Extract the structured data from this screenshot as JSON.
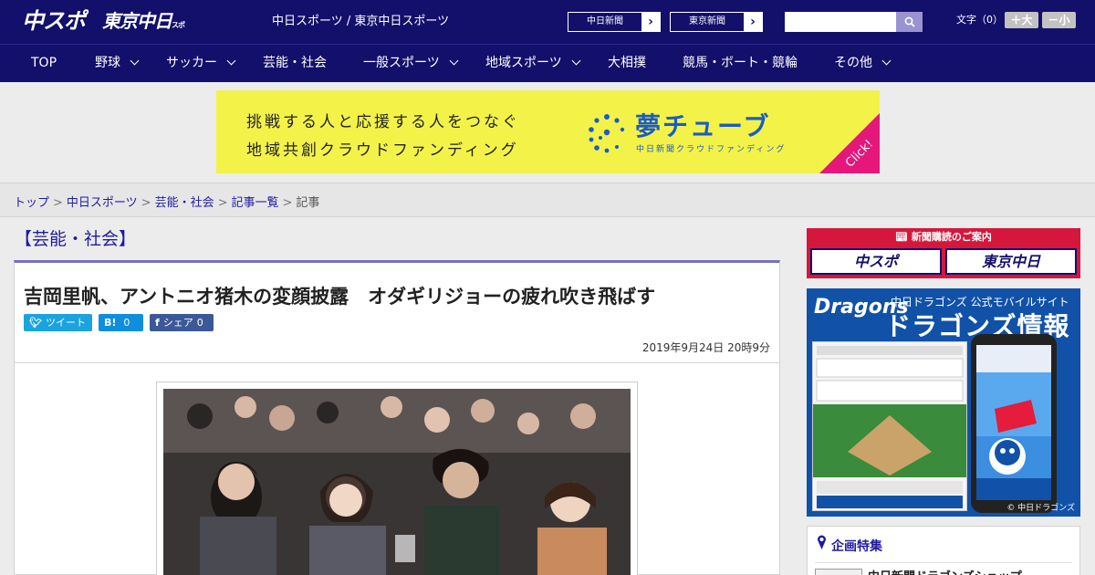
{
  "header": {
    "logo_chuspo": "中スポ",
    "logo_tokyo": "東京中日",
    "logo_tokyo_small": "スポーツ",
    "site_links": "中日スポーツ / 東京中日スポーツ",
    "paper1": "中日新聞",
    "paper2": "東京新聞",
    "search_placeholder": "",
    "font_label": "文字（0）",
    "font_big": "＋大",
    "font_small": "－小"
  },
  "nav": [
    {
      "label": "TOP"
    },
    {
      "label": "野球"
    },
    {
      "label": "サッカー"
    },
    {
      "label": "芸能・社会"
    },
    {
      "label": "一般スポーツ"
    },
    {
      "label": "地域スポーツ"
    },
    {
      "label": "大相撲"
    },
    {
      "label": "競馬・ボート・競輪"
    },
    {
      "label": "その他"
    }
  ],
  "ad": {
    "line1": "挑戦する人と応援する人をつなぐ",
    "line2": "地域共創クラウドファンディング",
    "brand": "夢チューブ",
    "sub": "中日新聞クラウドファンディング",
    "click": "Click!",
    "brand_color": "#1c5cc5",
    "bg_color": "#f3f249",
    "corner_color": "#e5177a"
  },
  "breadcrumb": {
    "items": [
      "トップ",
      "中日スポーツ",
      "芸能・社会",
      "記事一覧"
    ],
    "current": "記事"
  },
  "article": {
    "category": "【芸能・社会】",
    "title": "吉岡里帆、アントニオ猪木の変顔披露　オダギリジョーの疲れ吹き飛ばす",
    "share_tweet": "ツイート",
    "share_hatena_icon": "B!",
    "share_hatena_count": "0",
    "share_fb": "シェア",
    "share_fb_count": "0",
    "date": "2019年9月24日 20時9分"
  },
  "sidebar": {
    "subscribe_title": "新聞購読のご案内",
    "sub_logo1": "中スポ",
    "sub_logo2": "東京中日",
    "dragons_logo": "Dragons",
    "dragons_sub": "中日ドラゴンズ 公式モバイルサイト",
    "dragons_big": "ドラゴンズ情報",
    "dragons_copy": "© 中日ドラゴンズ",
    "feature_title": "企画特集",
    "feature_item": "中日新聞ドラゴンズショップ"
  },
  "colors": {
    "header_bg": "#13106b",
    "link": "#1f1ba0",
    "subscribe_red": "#d6173c",
    "dragons_blue": "#1152a8"
  }
}
